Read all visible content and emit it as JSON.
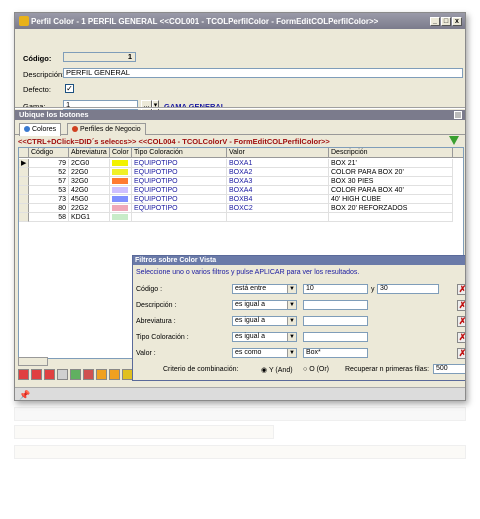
{
  "window": {
    "title": "Perfil Color - 1  PERFIL GENERAL  <<COL001 - TCOLPerfilColor - FormEditCOLPerfilColor>>",
    "btn_min": "_",
    "btn_max": "□",
    "btn_close": "x"
  },
  "header": {
    "codigo_label": "Código:",
    "codigo_value": "1",
    "descripcion_label": "Descripción:",
    "descripcion_value": "PERFIL GENERAL",
    "defecto_label": "Defecto:",
    "defecto_checked": "✓",
    "gama_label": "Gama:",
    "gama_value": "1",
    "gama_button": "...",
    "gama_dropdown": "▾",
    "gama_name": "GAMA GENERAL"
  },
  "section": {
    "title": "Ubique los botones",
    "close": "x"
  },
  "tabs": [
    {
      "label": "Colores",
      "icon_color": "#3a7ad0"
    },
    {
      "label": "Perfiles de Negocio",
      "icon_color": "#d04020"
    }
  ],
  "hint": "<<CTRL+DClick=DID´s seleccs>> <<COL004 - TCOLColorV - FormEditCOLPerfilColor>>",
  "grid": {
    "columns": [
      "Código",
      "Abreviatura",
      "Color",
      "Tipo Coloración",
      "Valor",
      "Descripción"
    ],
    "rows": [
      {
        "codigo": "79",
        "abrev": "2CG0",
        "color": "#f2f200",
        "tipo": "EQUIPOTIPO",
        "valor": "BOXA1",
        "desc": "BOX 21'"
      },
      {
        "codigo": "52",
        "abrev": "22G0",
        "color": "#f0f028",
        "tipo": "EQUIPOTIPO",
        "valor": "BOXA2",
        "desc": "COLOR PARA BOX 20'"
      },
      {
        "codigo": "57",
        "abrev": "32G0",
        "color": "#ff7a30",
        "tipo": "EQUIPOTIPO",
        "valor": "BOXA3",
        "desc": "BOX 30 PIES"
      },
      {
        "codigo": "53",
        "abrev": "42G0",
        "color": "#cfc0ff",
        "tipo": "EQUIPOTIPO",
        "valor": "BOXA4",
        "desc": "COLOR PARA BOX 40'"
      },
      {
        "codigo": "73",
        "abrev": "45G0",
        "color": "#8090ff",
        "tipo": "EQUIPOTIPO",
        "valor": "BOXB4",
        "desc": "40' HIGH CUBE"
      },
      {
        "codigo": "80",
        "abrev": "22G2",
        "color": "#f0a8b8",
        "tipo": "EQUIPOTIPO",
        "valor": "BOXC2",
        "desc": "BOX 20' REFORZADOS"
      },
      {
        "codigo": "58",
        "abrev": "KDG1",
        "color": "#c8ecc8",
        "tipo": "",
        "valor": "",
        "desc": ""
      }
    ]
  },
  "filter": {
    "title": "Filtros sobre Color Vista",
    "message": "Seleccione uno o varios filtros y pulse APLICAR para ver los resultados.",
    "rows": [
      {
        "label": "Código :",
        "op": "está entre",
        "v1": "10",
        "sep": "y",
        "v2": "30"
      },
      {
        "label": "Descripción :",
        "op": "es igual a",
        "v1": ""
      },
      {
        "label": "Abreviatura :",
        "op": "es igual a",
        "v1": ""
      },
      {
        "label": "Tipo Coloración :",
        "op": "es igual a",
        "v1": ""
      },
      {
        "label": "Valor :",
        "op": "es como",
        "v1": "Box*"
      }
    ],
    "criterio_label": "Criterio de combinación:",
    "opt_and": "Y (And)",
    "opt_or": "O (Or)",
    "recuperar_label": "Recuperar n primeras filas:",
    "recuperar_value": "500",
    "clear_glyph": "✗"
  },
  "status": {
    "pin": "📌"
  }
}
